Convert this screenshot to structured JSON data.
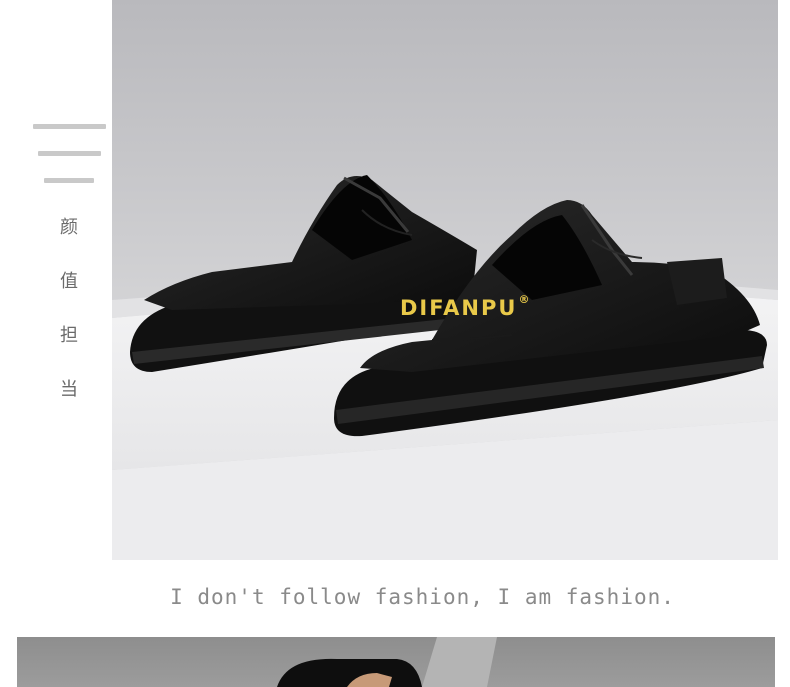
{
  "brand": {
    "name": "DIFANPU",
    "mark": "®"
  },
  "side_label": {
    "chars": [
      "颜",
      "值",
      "担",
      "当"
    ]
  },
  "tagline": "I don't follow fashion, I am fashion.",
  "icons": {
    "menu": "menu-lines-icon"
  }
}
